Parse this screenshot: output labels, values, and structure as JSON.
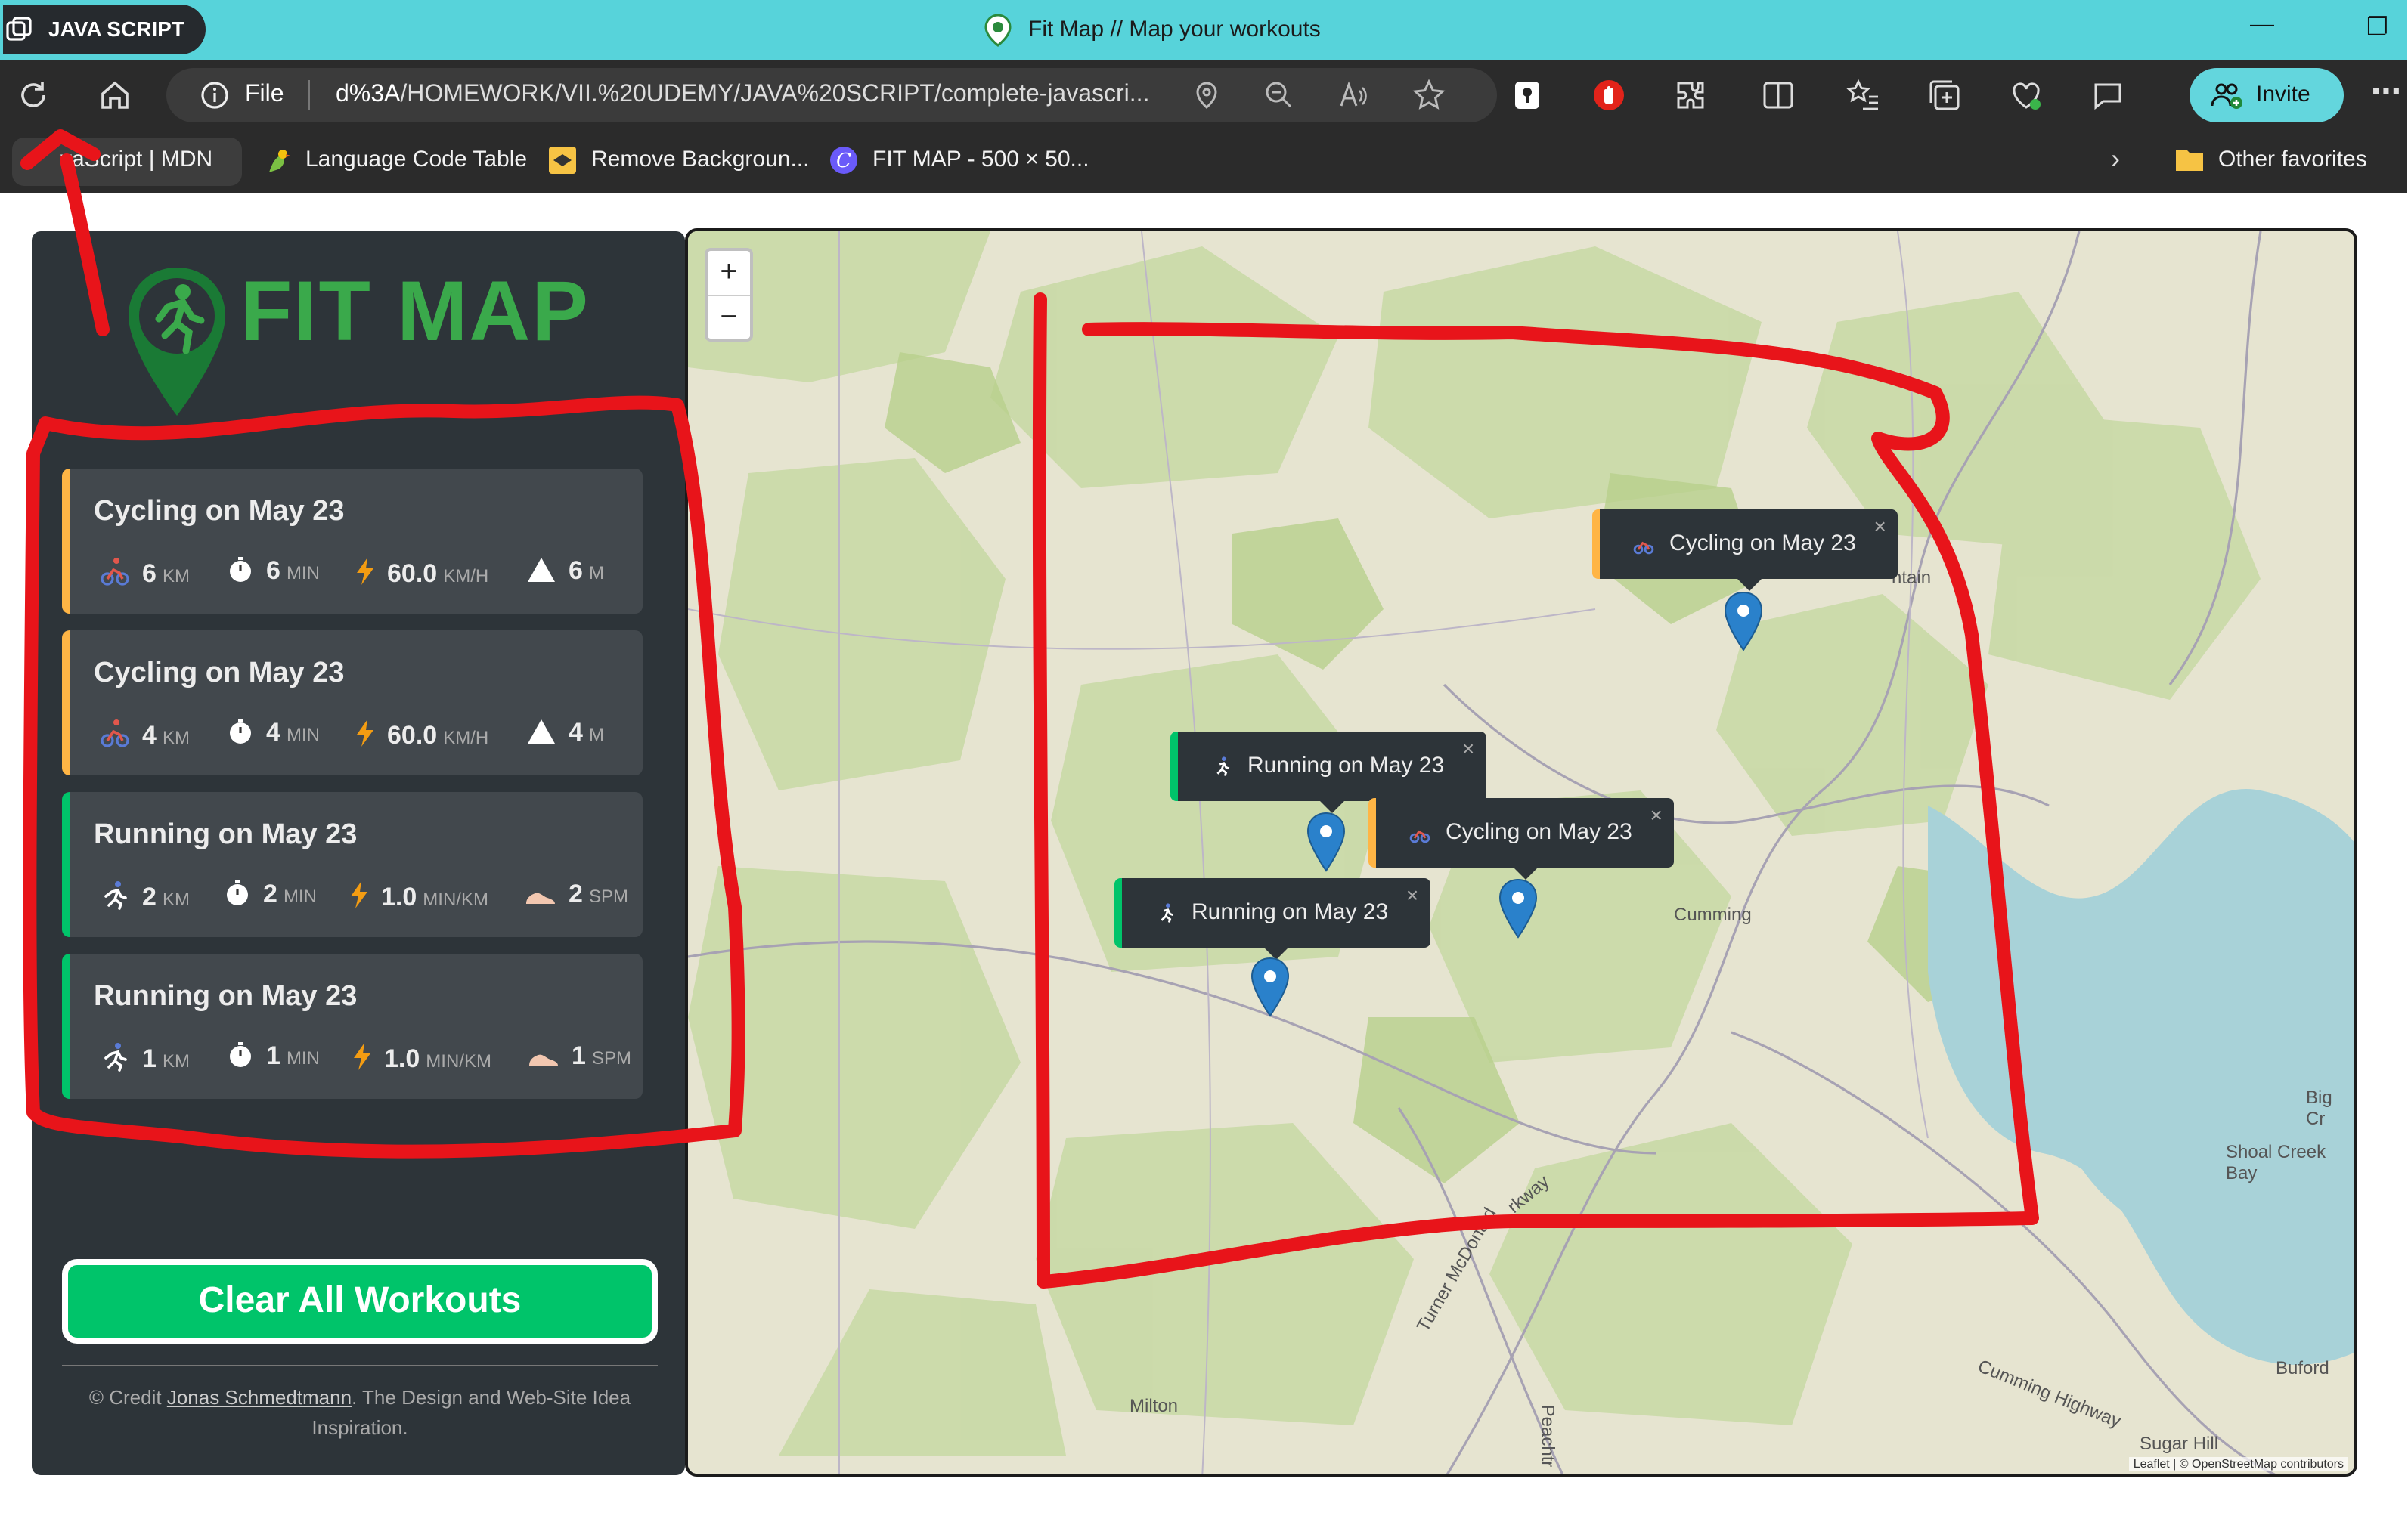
{
  "browser": {
    "profile_label": "JAVA SCRIPT",
    "window_title": "Fit Map // Map your workouts",
    "address_scheme": "File",
    "url_host": "d%3A",
    "url_path": "/HOMEWORK/VII.%20UDEMY/JAVA%20SCRIPT/complete-javascri...",
    "invite_label": "Invite",
    "bookmarks": [
      "vaScript | MDN",
      "Language Code Table",
      "Remove Backgroun...",
      "FIT MAP - 500 × 50..."
    ],
    "other_favorites": "Other favorites"
  },
  "sidebar": {
    "logo_text": "FIT MAP",
    "workouts": [
      {
        "type": "cycling",
        "title": "Cycling on May 23",
        "distance": "6",
        "distance_unit": "KM",
        "duration": "6",
        "duration_unit": "MIN",
        "speed": "60.0",
        "speed_unit": "KM/H",
        "extra": "6",
        "extra_unit": "M"
      },
      {
        "type": "cycling",
        "title": "Cycling on May 23",
        "distance": "4",
        "distance_unit": "KM",
        "duration": "4",
        "duration_unit": "MIN",
        "speed": "60.0",
        "speed_unit": "KM/H",
        "extra": "4",
        "extra_unit": "M"
      },
      {
        "type": "running",
        "title": "Running on May 23",
        "distance": "2",
        "distance_unit": "KM",
        "duration": "2",
        "duration_unit": "MIN",
        "speed": "1.0",
        "speed_unit": "MIN/KM",
        "extra": "2",
        "extra_unit": "SPM"
      },
      {
        "type": "running",
        "title": "Running on May 23",
        "distance": "1",
        "distance_unit": "KM",
        "duration": "1",
        "duration_unit": "MIN",
        "speed": "1.0",
        "speed_unit": "MIN/KM",
        "extra": "1",
        "extra_unit": "SPM"
      }
    ],
    "clear_button": "Clear All Workouts",
    "credit_prefix": "© Credit ",
    "credit_link": "Jonas Schmedtmann",
    "credit_suffix": ". The Design and Web-Site Idea Inspiration."
  },
  "map": {
    "zoom_in": "+",
    "zoom_out": "−",
    "popups": [
      {
        "type": "cycling",
        "label": "Cycling on May 23",
        "close": "×"
      },
      {
        "type": "running",
        "label": "Running on May 23",
        "close": "×"
      },
      {
        "type": "cycling",
        "label": "Cycling on May 23",
        "close": "×"
      },
      {
        "type": "running",
        "label": "Running on May 23",
        "close": "×"
      }
    ],
    "places": [
      "Cumming",
      "Milton",
      "Buford",
      "Sugar Hill",
      "Shoal Creek Bay",
      "Big Cr",
      "ntain",
      "Cumming Highway",
      "Turner McDonald",
      "rkway",
      "Peachtr"
    ],
    "attribution": "Leaflet | © OpenStreetMap contributors"
  },
  "colors": {
    "cycling": "#ffb545",
    "running": "#00c46a",
    "accent": "#00c46a",
    "annotation": "#e8141a",
    "pin": "#2a81cb"
  }
}
